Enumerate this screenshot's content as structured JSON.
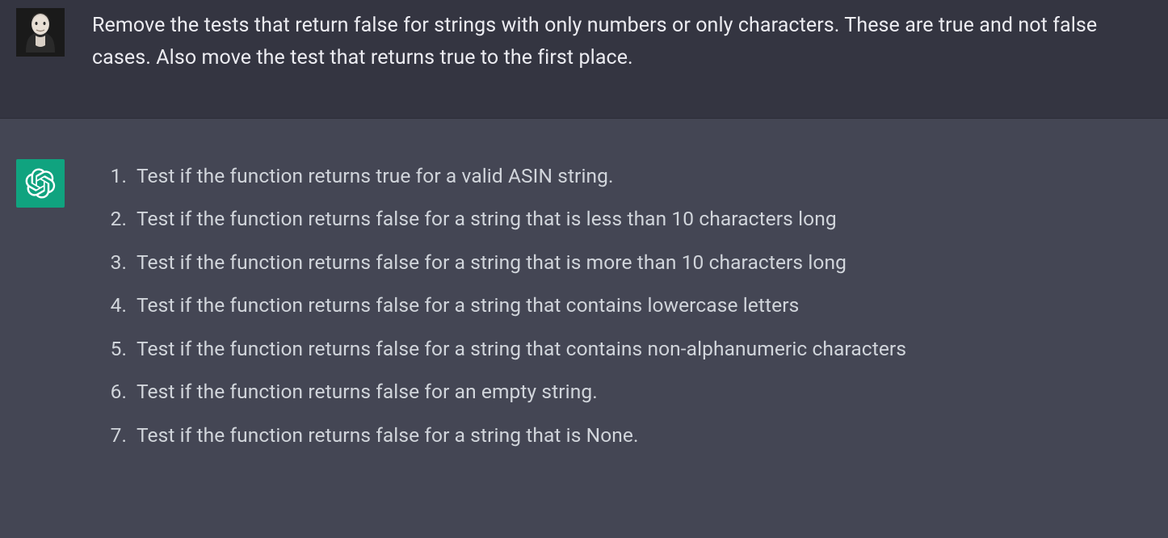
{
  "user_message": {
    "text": "Remove the tests that return false for strings with only numbers or only characters. These are true and not false cases. Also move the test that returns true to the first place."
  },
  "assistant_message": {
    "list_items": [
      "Test if the function returns true for a valid ASIN string.",
      "Test if the function returns false for a string that is less than 10 characters long",
      "Test if the function returns false for a string that is more than 10 characters long",
      "Test if the function returns false for a string that contains lowercase letters",
      "Test if the function returns false for a string that contains non-alphanumeric characters",
      "Test if the function returns false for an empty string.",
      "Test if the function returns false for a string that is None."
    ]
  }
}
